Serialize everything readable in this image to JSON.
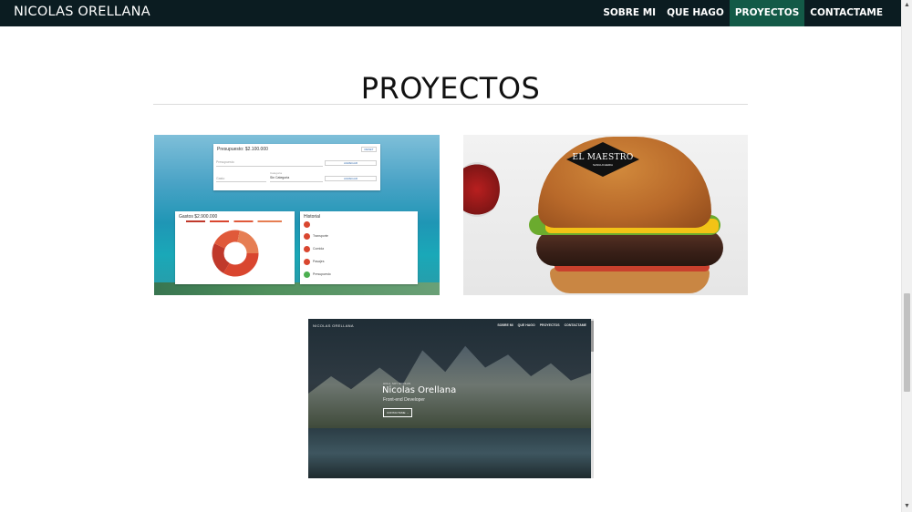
{
  "header": {
    "brand": "NICOLAS ORELLANA",
    "nav": [
      {
        "label": "SOBRE MI",
        "active": false
      },
      {
        "label": "QUE HAGO",
        "active": false
      },
      {
        "label": "PROYECTOS",
        "active": true
      },
      {
        "label": "CONTACTAME",
        "active": false
      }
    ],
    "active_color": "#135a47",
    "bg_color": "#0b1c21"
  },
  "section": {
    "title": "PROYECTOS"
  },
  "projects": [
    {
      "name": "budget-app",
      "budget_title": "Presupuesto: $2.100.000",
      "reset": "RESET",
      "presupuesto_placeholder": "Presupuesto",
      "agregar": "AGREGAR",
      "gasto_placeholder": "Gasto",
      "categoria_label": "Categoria",
      "categoria_value": "Sin Categoria",
      "gastos_title": "Gastos $2.900.000",
      "historial_title": "Historial",
      "historial": [
        "Transporte",
        "Comida",
        "Pasajes",
        "Presupuesto"
      ]
    },
    {
      "name": "el-maestro",
      "logo": "EL MAESTRO",
      "logo_sub": "SANGUCHERIA"
    },
    {
      "name": "portfolio",
      "mini_brand": "NICOLAS ORELLANA",
      "mini_nav": [
        "SOBRE MI",
        "QUE HAGO",
        "PROYECTOS",
        "CONTACTAME"
      ],
      "greeting": "HOLA, SOY NICOLAS",
      "name_text": "Nicolas Orellana",
      "role": "Front-end Developer",
      "cta": "CONTACTAME →"
    }
  ]
}
